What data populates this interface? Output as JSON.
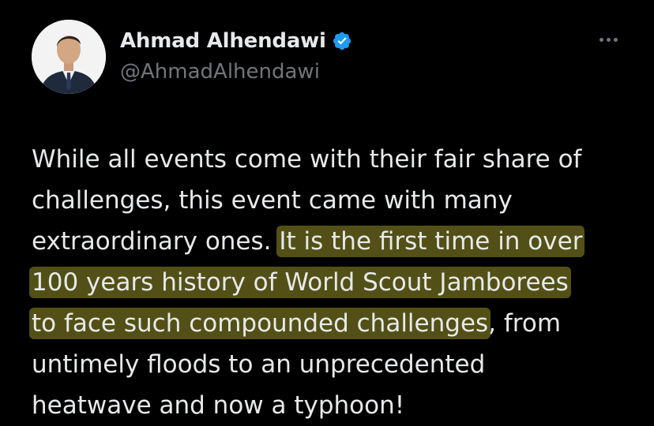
{
  "author": {
    "display_name": "Ahmad Alhendawi",
    "handle": "@AhmadAlhendawi",
    "verified": true,
    "avatar_icon": "profile-photo"
  },
  "menu": {
    "icon": "more-options-icon"
  },
  "tweet": {
    "lines": [
      {
        "plain_before": "While all events come with their fair share of",
        "highlight": "",
        "plain_after": ""
      },
      {
        "plain_before": "challenges, this event came with many",
        "highlight": "",
        "plain_after": ""
      },
      {
        "plain_before": "extraordinary ones. ",
        "highlight": "It is the first time in over",
        "plain_after": ""
      },
      {
        "plain_before": "",
        "highlight": "100 years history of World Scout Jamborees",
        "plain_after": ""
      },
      {
        "plain_before": "",
        "highlight": "to face such compounded challenges",
        "plain_after": ", from"
      },
      {
        "plain_before": "untimely floods to an unprecedented",
        "highlight": "",
        "plain_after": ""
      },
      {
        "plain_before": "heatwave and now a typhoon!",
        "highlight": "",
        "plain_after": ""
      }
    ]
  },
  "colors": {
    "background": "#000000",
    "text": "#e7e9ea",
    "secondary_text": "#71767b",
    "verified_blue": "#1d9bf0",
    "highlight": "#969128"
  }
}
